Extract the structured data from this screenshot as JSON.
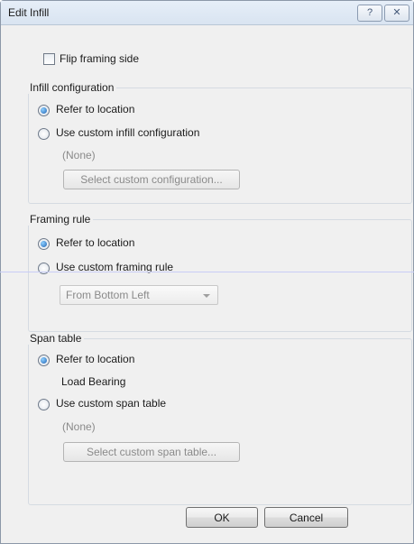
{
  "window": {
    "title": "Edit Infill",
    "help_glyph": "?",
    "close_glyph": "✕"
  },
  "flip_label": "Flip framing side",
  "infill": {
    "legend": "Infill configuration",
    "refer_label": "Refer to location",
    "custom_label": "Use custom infill configuration",
    "custom_value": "(None)",
    "select_button": "Select custom configuration..."
  },
  "framing": {
    "legend": "Framing rule",
    "refer_label": "Refer to location",
    "custom_label": "Use custom framing rule",
    "dropdown_value": "From Bottom Left"
  },
  "span": {
    "legend": "Span table",
    "refer_label": "Refer to location",
    "location_value": "Load Bearing",
    "custom_label": "Use custom span table",
    "custom_value": "(None)",
    "select_button": "Select custom span table..."
  },
  "footer": {
    "ok_label": "OK",
    "cancel_label": "Cancel"
  }
}
